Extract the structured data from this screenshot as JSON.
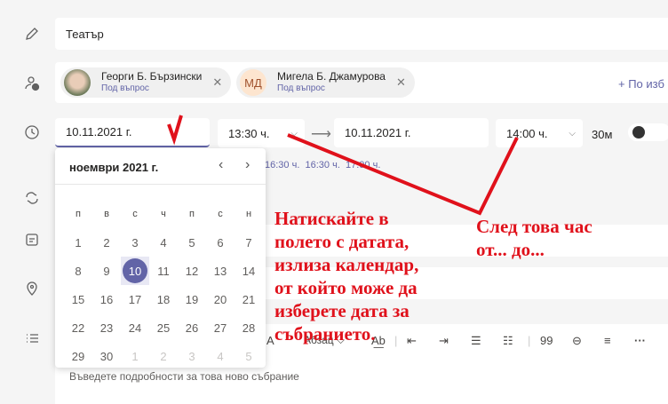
{
  "title": {
    "value": "Театър"
  },
  "attendees": [
    {
      "name": "Георги Б. Бързински",
      "status": "Под въпрос",
      "initials": ""
    },
    {
      "name": "Мигела Б. Джамурова",
      "status": "Под въпрос",
      "initials": "МД"
    }
  ],
  "optional_label": "+ По изб",
  "time": {
    "start_date": "10.11.2021 г.",
    "start_time": "13:30 ч.",
    "end_date": "10.11.2021 г.",
    "end_time": "14:00 ч.",
    "duration": "30м",
    "all_day": false,
    "suggestions": [
      "16:30 ч.",
      "16:30 ч.",
      "17:00 ч."
    ]
  },
  "calendar": {
    "month_label": "ноември 2021 г.",
    "weekdays": [
      "п",
      "в",
      "с",
      "ч",
      "п",
      "с",
      "н"
    ],
    "days": [
      [
        "1",
        "2",
        "3",
        "4",
        "5",
        "6",
        "7"
      ],
      [
        "8",
        "9",
        "10",
        "11",
        "12",
        "13",
        "14"
      ],
      [
        "15",
        "16",
        "17",
        "18",
        "19",
        "20",
        "21"
      ],
      [
        "22",
        "23",
        "24",
        "25",
        "26",
        "27",
        "28"
      ],
      [
        "29",
        "30",
        "1",
        "2",
        "3",
        "4",
        "5"
      ]
    ],
    "selected": "10"
  },
  "editor": {
    "paragraph_label": "Абзац",
    "quote": "99",
    "placeholder": "Въведете подробности за това ново събрание"
  },
  "annotations": {
    "left": [
      "Натискайте в",
      "полето с датата,",
      "излиза календар,",
      "от който може да",
      "изберете дата за",
      "събранието."
    ],
    "right": [
      "След това час",
      "от... до..."
    ]
  },
  "colors": {
    "accent": "#6264a7",
    "annotation": "#e0111b"
  }
}
